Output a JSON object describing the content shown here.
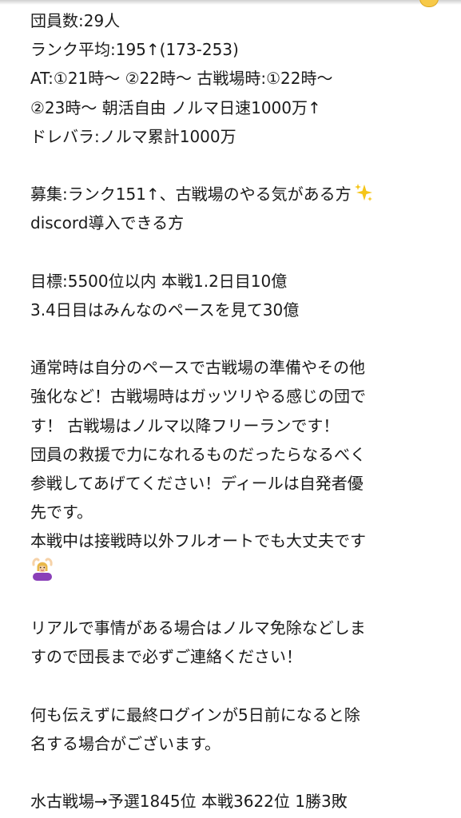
{
  "note": {
    "lines": [
      "団員数:29人",
      "ランク平均:195↑(173-253)",
      "AT:①21時〜 ②22時〜 古戦場時:①22時〜",
      "②23時〜  朝活自由 ノルマ日速1000万↑",
      "ドレバラ:ノルマ累計1000万",
      "募集:ランク151↑、古戦場のやる気がある方",
      "discord導入できる方",
      "目標:5500位以内 本戦1.2日目10億",
      "3.4日目はみんなのペースを見て30億",
      "通常時は自分のペースで古戦場の準備やその他",
      "強化など！古戦場時はガッツリやる感じの団で",
      "す！ 古戦場はノルマ以降フリーランです！",
      "団員の救援で力になれるものだったらなるべく",
      "参戦してあげてください！ディールは自発者優",
      "先です。",
      "本戦中は接戦時以外フルオートでも大丈夫です",
      "リアルで事情がある場合はノルマ免除などしま",
      "すので団長まで必ずご連絡ください！",
      "何も伝えずに最終ログインが5日前になると除",
      "名する場合がございます。",
      "水古戦場→予選1845位 本戦3622位 1勝3敗"
    ],
    "icons": {
      "sparkle": "sparkles-icon",
      "person": "person-gesturing-ok-icon"
    },
    "colors": {
      "text": "#1a1a1a",
      "background": "#ffffff"
    }
  }
}
